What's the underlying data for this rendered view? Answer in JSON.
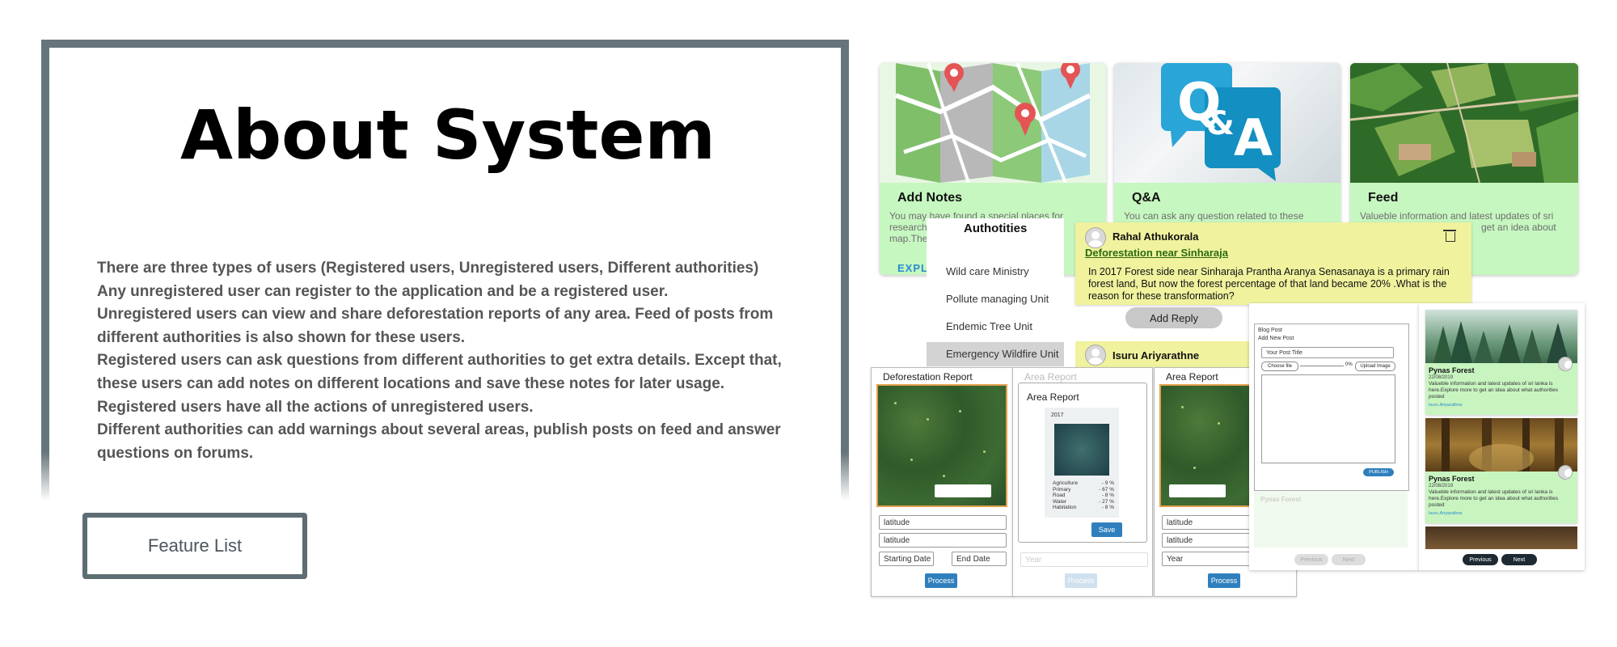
{
  "about": {
    "title": "About System",
    "paragraphs": [
      "There are three types of users (Registered users, Unregistered users, Different authorities)",
      "Any unregistered user can register to the application and be a registered user.",
      "Unregistered users can view and share deforestation reports of any area. Feed of posts from different authorities is also shown for these users.",
      "Registered users can ask questions from different authorities to get extra details. Except that, these users can add notes on different locations and save these notes for later usage.",
      "Registered users have all the actions of unregistered users.",
      "Different authorities can add warnings about several areas, publish posts on feed and answer questions on forums."
    ],
    "feature_button": "Feature List"
  },
  "cards": [
    {
      "title": "Add Notes",
      "desc": "You may have found a special places for research,",
      "desc2": "map.The",
      "link": "EXPLO"
    },
    {
      "title": "Q&A",
      "desc": "You can ask any question related to these"
    },
    {
      "title": "Feed",
      "desc": "Valueble information and latest updates of sri",
      "desc2": "get an idea about"
    }
  ],
  "qa_logo": {
    "q": "Q",
    "amp": "&",
    "a": "A"
  },
  "authorities": {
    "header": "Authotities",
    "items": [
      "Wild care Ministry",
      "Pollute managing Unit",
      "Endemic Tree Unit",
      "Emergency Wildfire Unit"
    ]
  },
  "question": {
    "name": "Rahal Athukorala",
    "subject": "Deforestation near Sinharaja",
    "body": "In 2017 Forest side near Sinharaja Prantha Aranya Senasanaya is a primary rain forest land, But now the forest percentage of that land became 20% .What is the reason for these transformation?",
    "reply": "Add Reply",
    "second_name": "Isuru Ariyarathne"
  },
  "reports": {
    "deforestation_title": "Deforestation Report",
    "area_title": "Area Report",
    "latitude": "latitude",
    "starting_date": "Starting Date",
    "end_date": "End Date",
    "process": "Process",
    "year": "Year",
    "area_year": "2017",
    "stats": [
      {
        "label": "Agriculture",
        "value": "- 9 %"
      },
      {
        "label": "Primary",
        "value": "- 67 %"
      },
      {
        "label": "Road",
        "value": "- 8 %"
      },
      {
        "label": "Water",
        "value": "- 27 %"
      },
      {
        "label": "Habitation",
        "value": "- 8 %"
      }
    ],
    "save": "Save"
  },
  "blog": {
    "header": "Blog Post",
    "sub": "Add New Post",
    "title_placeholder": "Your Post Title",
    "choose": "Choose file",
    "progress": "0%",
    "upload": "Upload Image",
    "publish": "PUBLISH",
    "faded_title": "Pynas Forest",
    "prev": "Previous",
    "next": "Next"
  },
  "feed_items": [
    {
      "title": "Pynas Forest",
      "date": "22/08/2019",
      "desc": "Valueble information and latest updates of sri lanka is here.Explore more to get an idea about what authorities posted",
      "link": "Isuru Ariyarathne"
    },
    {
      "title": "Pynas Forest",
      "date": "22/08/2019",
      "desc": "Valueble information and latest updates of sri lanka is here.Explore more to get an idea about what authorities posted",
      "link": "Isuru Ariyarathne"
    }
  ],
  "pager": {
    "prev": "Previous",
    "next": "Next"
  },
  "colors": {
    "frame": "#66757b",
    "card_green": "#c6f7c0",
    "qa_yellow": "#f0f29e",
    "accent_blue": "#2f7fbd"
  }
}
